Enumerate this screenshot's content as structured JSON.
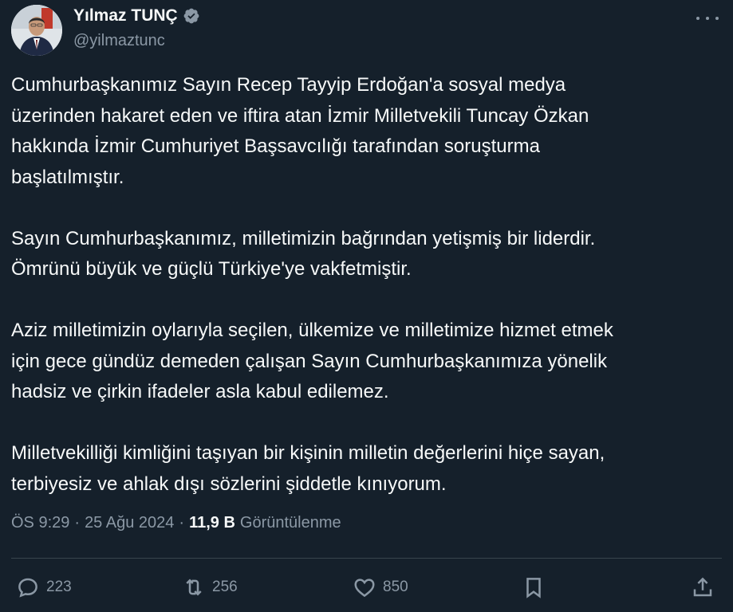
{
  "author": {
    "name": "Yılmaz TUNÇ",
    "handle": "@yilmaztunc",
    "verified": true
  },
  "tweet": {
    "paragraphs": [
      "Cumhurbaşkanımız Sayın Recep Tayyip Erdoğan'a sosyal medya\nüzerinden hakaret eden ve iftira atan İzmir Milletvekili Tuncay Özkan\nhakkında İzmir Cumhuriyet Başsavcılığı tarafından soruşturma\nbaşlatılmıştır.",
      "Sayın Cumhurbaşkanımız, milletimizin bağrından yetişmiş bir liderdir.\nÖmrünü büyük ve güçlü Türkiye'ye vakfetmiştir.",
      "Aziz milletimizin oylarıyla seçilen, ülkemize ve milletimize hizmet etmek\niçin gece gündüz demeden çalışan Sayın Cumhurbaşkanımıza yönelik\nhadsiz ve çirkin ifadeler asla kabul edilemez.",
      "Milletvekilliği kimliğini taşıyan bir kişinin milletin değerlerini hiçe sayan,\nterbiyesiz ve ahlak dışı sözlerini şiddetle kınıyorum."
    ]
  },
  "meta": {
    "time": "ÖS 9:29",
    "separator": "·",
    "date": "25 Ağu 2024",
    "views_count": "11,9 B",
    "views_label": "Görüntülenme"
  },
  "actions": {
    "replies": "223",
    "retweets": "256",
    "likes": "850"
  },
  "colors": {
    "background": "#15202b",
    "text": "#f7f9f9",
    "secondary": "#8b98a5",
    "verified": "#1d9bf0",
    "divider": "#38444d"
  },
  "icons": [
    "more-icon",
    "verified-badge-icon",
    "reply-icon",
    "retweet-icon",
    "like-icon",
    "bookmark-icon",
    "share-icon"
  ]
}
